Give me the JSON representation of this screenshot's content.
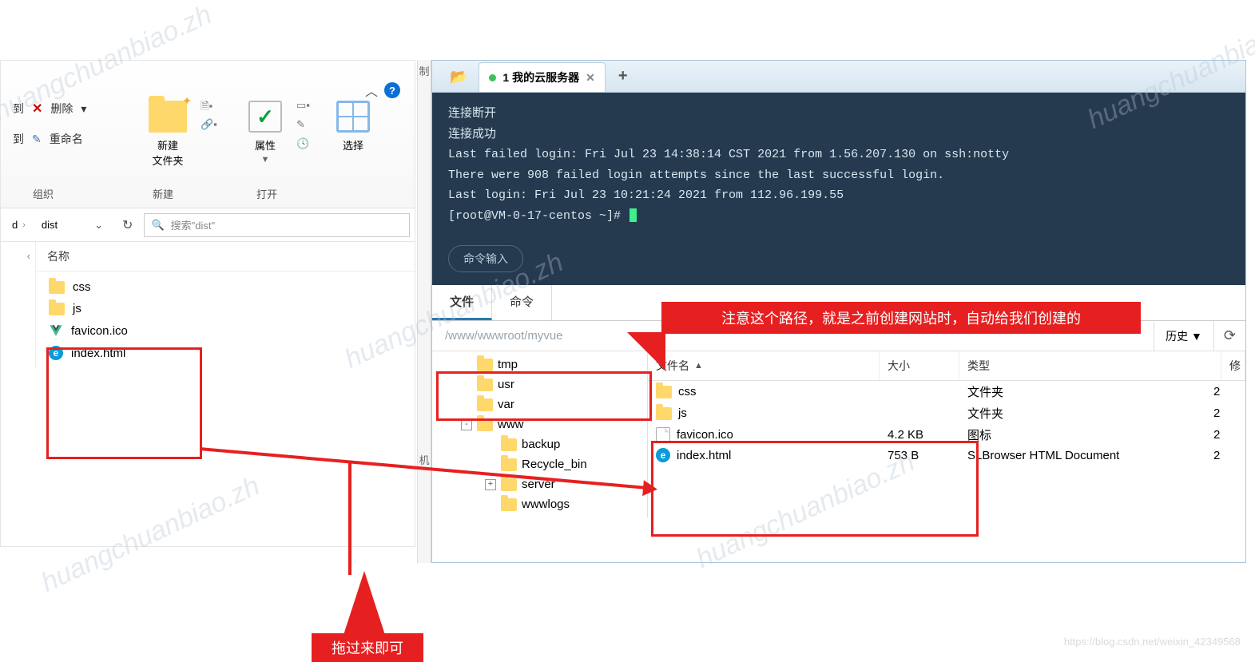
{
  "left_explorer": {
    "ribbon": {
      "delete_label": "删除",
      "rename_label": "重命名",
      "new_folder_label": "新建\n文件夹",
      "properties_label": "属性",
      "select_label": "选择",
      "group_organize": "组织",
      "group_new": "新建",
      "group_open": "打开",
      "to_label1": "到",
      "to_label2": "到",
      "side_copy": "制",
      "side_desktop": "机"
    },
    "breadcrumb": {
      "part1": "d",
      "part2": "dist"
    },
    "search_placeholder": "搜索\"dist\"",
    "column_name": "名称",
    "files": [
      {
        "name": "css",
        "kind": "folder"
      },
      {
        "name": "js",
        "kind": "folder"
      },
      {
        "name": "favicon.ico",
        "kind": "vue"
      },
      {
        "name": "index.html",
        "kind": "edge"
      }
    ]
  },
  "annotations": {
    "drag_note": "拖过来即可",
    "path_note": "注意这个路径，就是之前创建网站时，自动给我们创建的"
  },
  "right_panel": {
    "tab_title": "1 我的云服务器",
    "terminal_lines": [
      "连接断开",
      "连接成功",
      "Last failed login: Fri Jul 23 14:38:14 CST 2021 from 1.56.207.130 on ssh:notty",
      "There were 908 failed login attempts since the last successful login.",
      "Last login: Fri Jul 23 10:21:24 2021 from 112.96.199.55"
    ],
    "terminal_prompt": "[root@VM-0-17-centos ~]#",
    "cmd_input_label": "命令输入",
    "sub_tabs": {
      "files": "文件",
      "commands": "命令"
    },
    "path_value": "/www/wwwroot/myvue",
    "history_label": "历史",
    "tree": [
      {
        "name": "tmp",
        "indent": 1,
        "exp": ""
      },
      {
        "name": "usr",
        "indent": 1,
        "exp": ""
      },
      {
        "name": "var",
        "indent": 1,
        "exp": ""
      },
      {
        "name": "www",
        "indent": 1,
        "exp": "-"
      },
      {
        "name": "backup",
        "indent": 2,
        "exp": ""
      },
      {
        "name": "Recycle_bin",
        "indent": 2,
        "exp": ""
      },
      {
        "name": "server",
        "indent": 2,
        "exp": "+"
      },
      {
        "name": "wwwlogs",
        "indent": 2,
        "exp": ""
      }
    ],
    "grid_headers": {
      "name": "文件名",
      "size": "大小",
      "type": "类型",
      "mod": "修"
    },
    "grid_rows": [
      {
        "name": "css",
        "size": "",
        "type": "文件夹",
        "kind": "folder",
        "mod": "2"
      },
      {
        "name": "js",
        "size": "",
        "type": "文件夹",
        "kind": "folder",
        "mod": "2"
      },
      {
        "name": "favicon.ico",
        "size": "4.2 KB",
        "type": "图标",
        "kind": "file",
        "mod": "2"
      },
      {
        "name": "index.html",
        "size": "753 B",
        "type": "SLBrowser HTML Document",
        "kind": "edge",
        "mod": "2"
      }
    ]
  },
  "blog_watermark": "https://blog.csdn.net/weixin_42349568"
}
